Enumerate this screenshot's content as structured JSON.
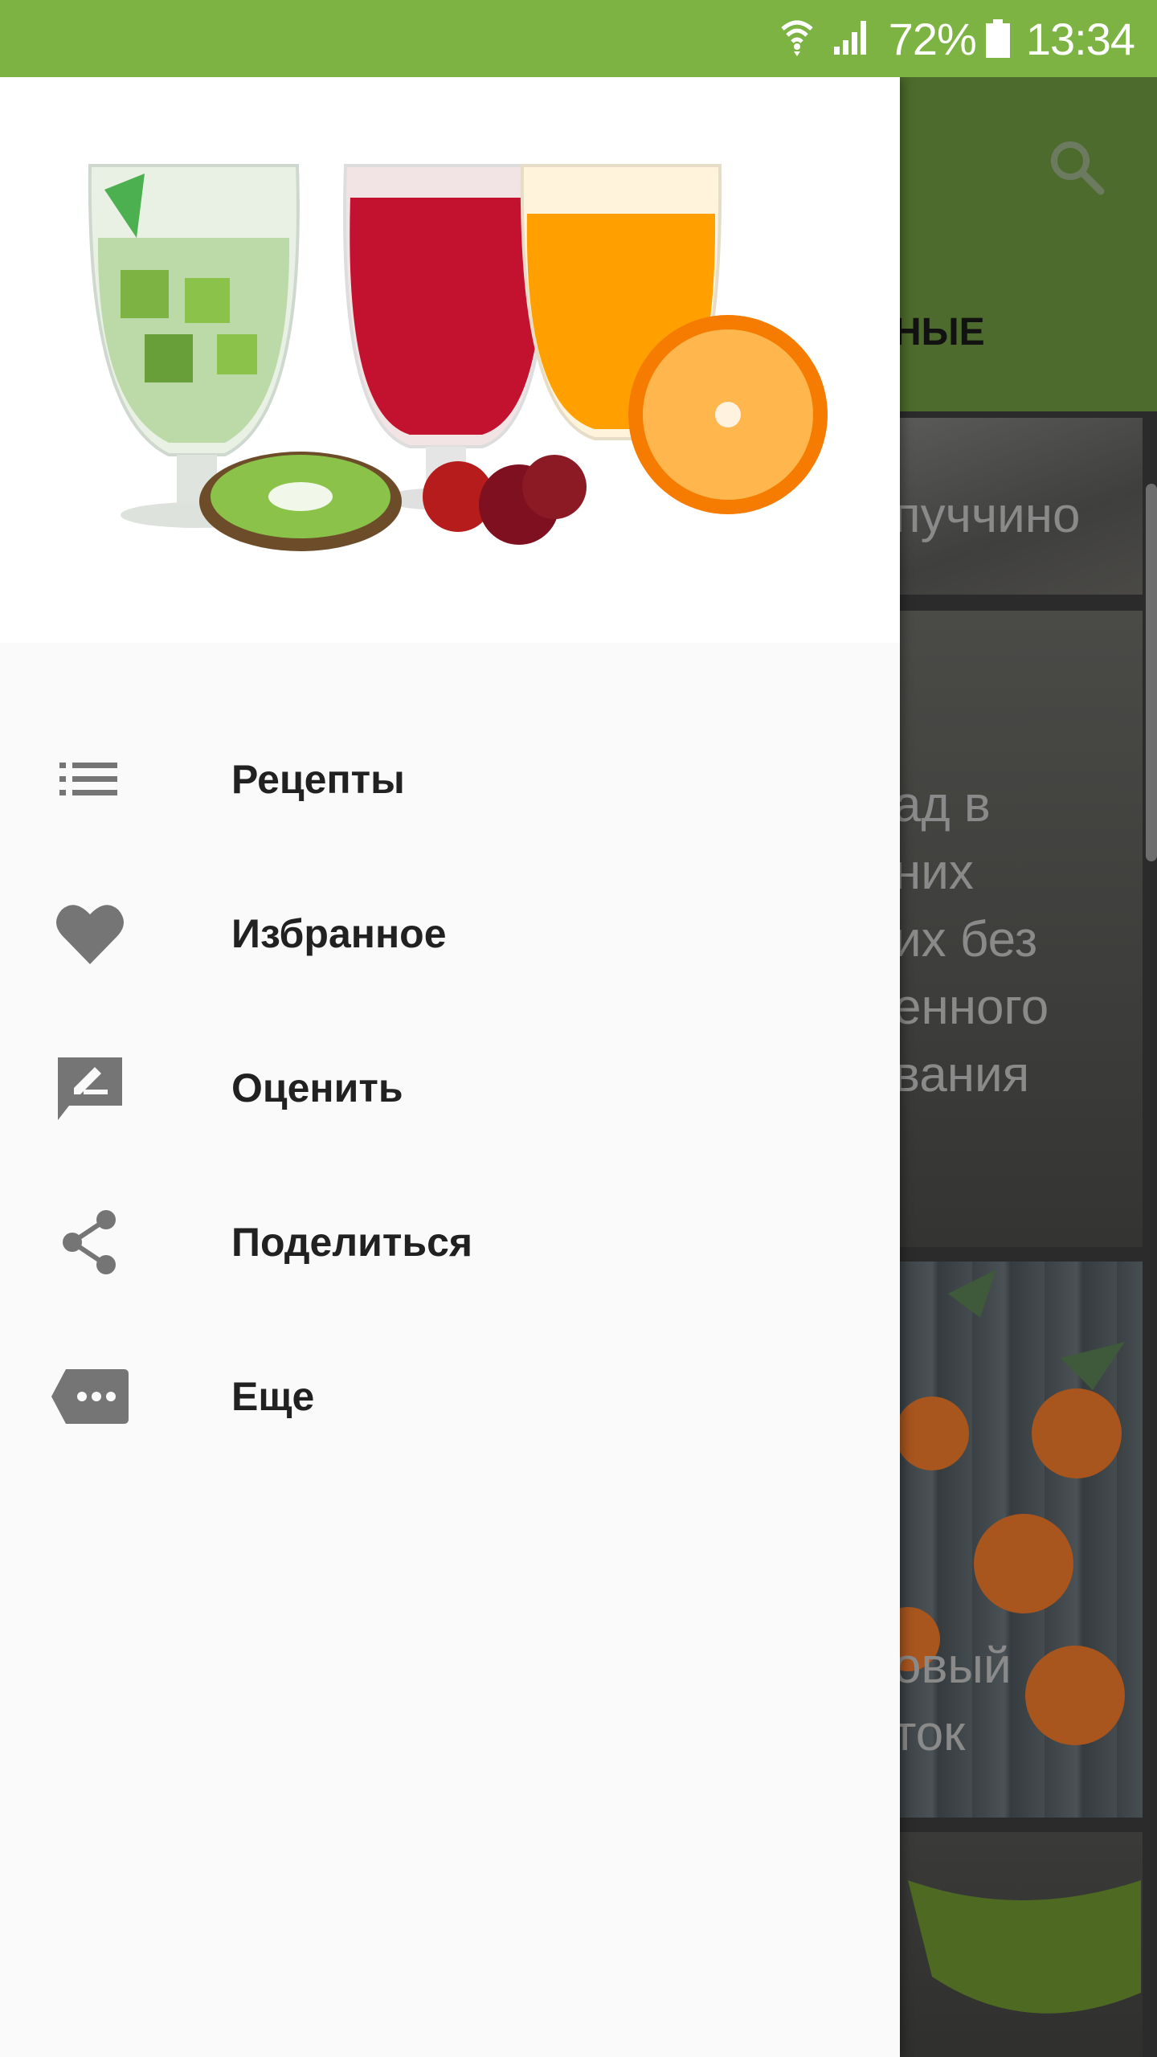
{
  "status_bar": {
    "battery_percent": "72%",
    "time": "13:34",
    "icons": [
      "wifi-icon",
      "signal-icon",
      "battery-icon"
    ],
    "background": "#7cb342"
  },
  "background_app": {
    "toolbar_color": "#4d6b2c",
    "tab_partial": "НЫЕ",
    "search_icon": "search-icon",
    "cards": [
      {
        "title_lines": [
          "пуччино"
        ]
      },
      {
        "title_lines": [
          "ад в",
          "них",
          "их без",
          "енного",
          "вания"
        ]
      },
      {
        "title_lines": [
          "овый",
          "ток"
        ]
      },
      {
        "title_lines": []
      }
    ]
  },
  "drawer": {
    "header_image": "juice-glasses-image",
    "menu": [
      {
        "icon": "list-icon",
        "label": "Рецепты"
      },
      {
        "icon": "heart-icon",
        "label": "Избранное"
      },
      {
        "icon": "rate-icon",
        "label": "Оценить"
      },
      {
        "icon": "share-icon",
        "label": "Поделиться"
      },
      {
        "icon": "more-icon",
        "label": "Еще"
      }
    ]
  }
}
